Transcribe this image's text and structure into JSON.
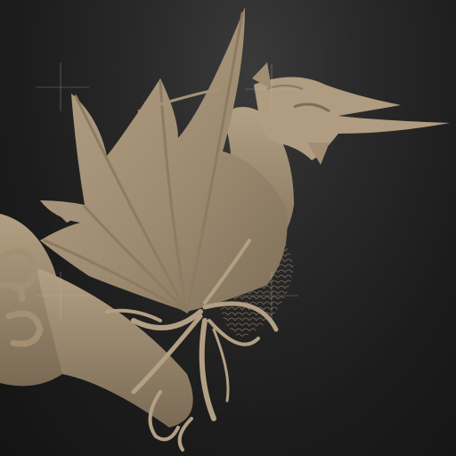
{
  "canvas": {
    "description_free": true,
    "background_top": "#3a3a3a",
    "background_bottom": "#141414",
    "model_color": "#a8957a"
  },
  "icons": [
    "crosshair-icon",
    "crosshair-icon",
    "crosshair-icon",
    "crosshair-icon"
  ]
}
